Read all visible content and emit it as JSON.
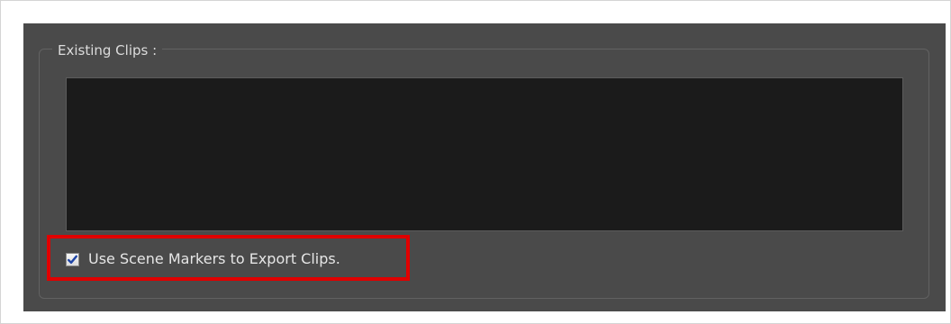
{
  "group": {
    "title": "Existing Clips :"
  },
  "clip_list": {
    "items": []
  },
  "use_scene_markers": {
    "label": "Use Scene Markers to Export Clips.",
    "checked": true
  },
  "colors": {
    "panel_background": "#4a4a4a",
    "list_background": "#1b1b1b",
    "highlight": "#e00000",
    "checkmark": "#1f45a6"
  },
  "icons": {
    "checkbox_mark": "checkmark-icon"
  }
}
